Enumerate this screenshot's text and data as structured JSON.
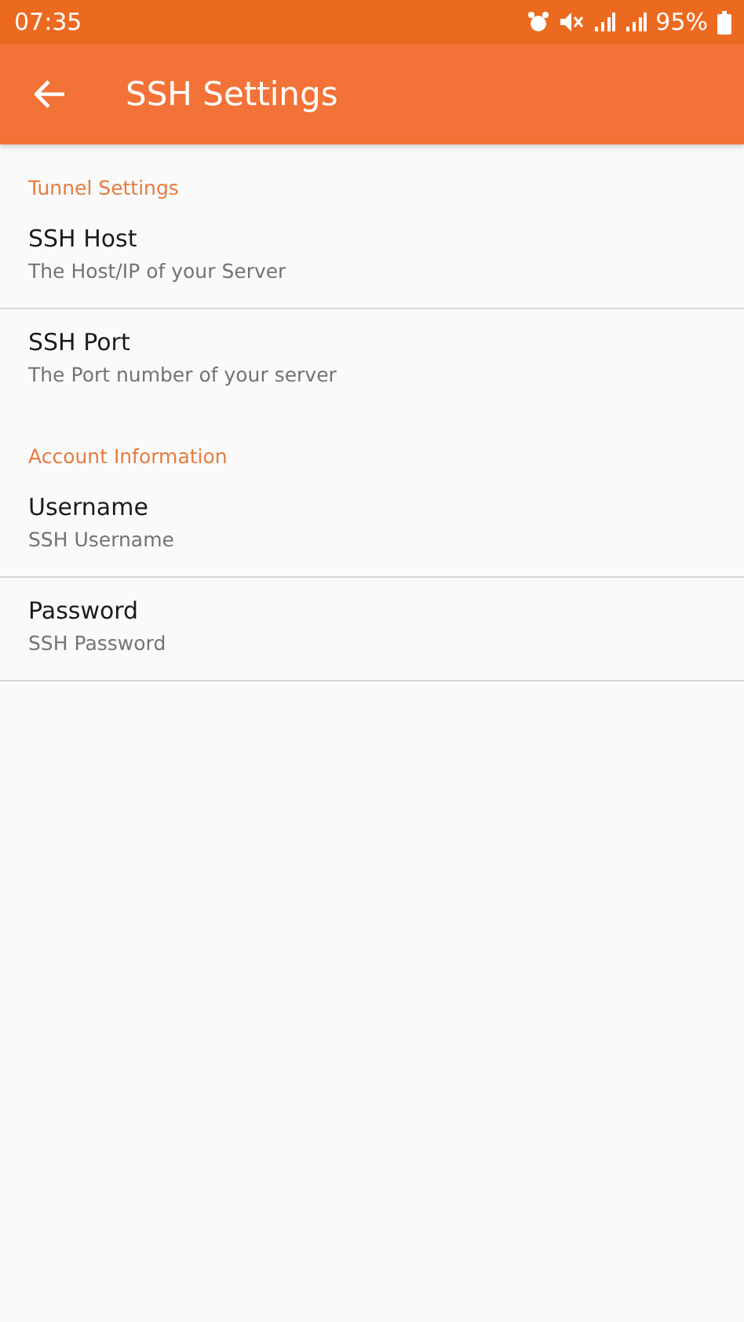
{
  "status_bar": {
    "time": "07:35",
    "battery": "95%"
  },
  "app_bar": {
    "title": "SSH Settings"
  },
  "sections": [
    {
      "title": "Tunnel Settings",
      "items": [
        {
          "title": "SSH Host",
          "summary": "The Host/IP of your Server",
          "divider": true
        },
        {
          "title": "SSH Port",
          "summary": "The Port number of your server",
          "divider": false
        }
      ]
    },
    {
      "title": "Account Information",
      "items": [
        {
          "title": "Username",
          "summary": "SSH Username",
          "divider": true
        },
        {
          "title": "Password",
          "summary": "SSH Password",
          "divider": true
        }
      ]
    }
  ]
}
